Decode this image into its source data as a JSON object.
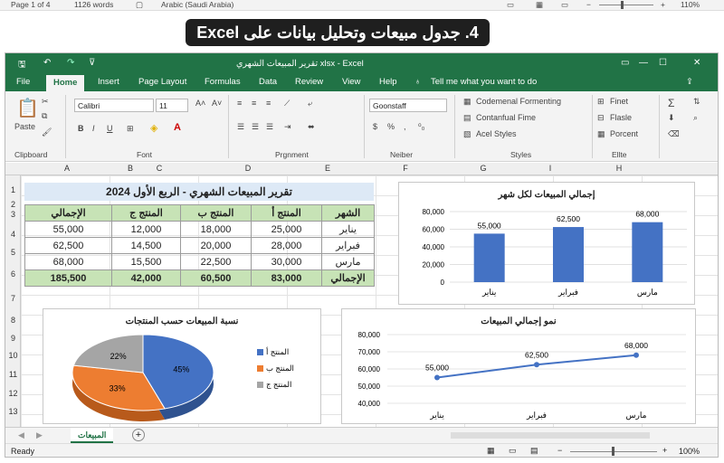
{
  "word_status": {
    "page": "Page 1 of 4",
    "words": "1126 words",
    "language": "Arabic (Saudi Arabia)",
    "zoom": "110%"
  },
  "banner": {
    "title": "4. جدول مبيعات وتحليل بيانات على Excel"
  },
  "window": {
    "title": "تقرير المبيعات الشهري xlsx - Excel",
    "search": "Tell me what you want to do"
  },
  "tabs": [
    "File",
    "Home",
    "Insert",
    "Page Layout",
    "Formulas",
    "Data",
    "Review",
    "View",
    "Help"
  ],
  "ribbon": {
    "clipboard": {
      "paste": "Paste",
      "label": "Clipboard"
    },
    "font": {
      "name": "Calibri",
      "size": "11",
      "label": "Font",
      "bold": "B",
      "italic": "I",
      "underline": "U"
    },
    "alignment": {
      "label": "Prgnment"
    },
    "number": {
      "format": "Goonstaff",
      "label": "Neiber"
    },
    "styles": {
      "items": [
        "Codemenal Formenting",
        "Contanfual Fime",
        "Acel Styles"
      ],
      "label": "Styles"
    },
    "cells": {
      "items": [
        "Finet",
        "Flasle",
        "Porcent"
      ],
      "label": "Ellte"
    }
  },
  "columns": [
    "A",
    "B",
    "C",
    "D",
    "E",
    "F",
    "G",
    "I",
    "H"
  ],
  "rows": [
    "1",
    "2",
    "3",
    "4",
    "5",
    "6",
    "7",
    "8",
    "9",
    "10",
    "11",
    "12",
    "13"
  ],
  "table": {
    "title": "تقرير المبيعات الشهري - الربع الأول 2024",
    "headers": [
      "الشهر",
      "المنتج أ",
      "المنتج ب",
      "المنتج ج",
      "الإجمالي"
    ],
    "rows": [
      [
        "يناير",
        "25,000",
        "18,000",
        "12,000",
        "55,000"
      ],
      [
        "فبراير",
        "28,000",
        "20,000",
        "14,500",
        "62,500"
      ],
      [
        "مارس",
        "30,000",
        "22,500",
        "15,500",
        "68,000"
      ]
    ],
    "total": [
      "الإجمالي",
      "83,000",
      "60,500",
      "42,000",
      "185,500"
    ]
  },
  "bar_chart": {
    "chart_data": {
      "type": "bar",
      "title": "إجمالي المبيعات لكل شهر",
      "categories": [
        "يناير",
        "فبراير",
        "مارس"
      ],
      "values": [
        55000,
        62500,
        68000
      ],
      "data_labels": [
        "55,000",
        "62,500",
        "68,000"
      ],
      "ylim": [
        0,
        80000
      ],
      "yticks": [
        "80,000",
        "60,000",
        "40,000",
        "20,000",
        "0"
      ]
    }
  },
  "pie_chart": {
    "chart_data": {
      "type": "pie",
      "title": "نسبة المبيعات حسب المنتجات",
      "labels": [
        "المنتج أ",
        "المنتج ب",
        "المنتج ج"
      ],
      "values": [
        45,
        33,
        22
      ],
      "data_labels": [
        "45%",
        "33%",
        "22%"
      ],
      "colors": [
        "#4472c4",
        "#ed7d31",
        "#a5a5a5"
      ]
    }
  },
  "line_chart": {
    "chart_data": {
      "type": "line",
      "title": "نمو إجمالي المبيعات",
      "categories": [
        "يناير",
        "فبراير",
        "مارس"
      ],
      "values": [
        55000,
        62500,
        68000
      ],
      "data_labels": [
        "55,000",
        "62,500",
        "68,000"
      ],
      "ylim": [
        40000,
        80000
      ],
      "yticks": [
        "80,000",
        "70,000",
        "60,000",
        "50,000",
        "40,000"
      ]
    }
  },
  "sheet": {
    "tab": "المبيعات",
    "add": "+"
  },
  "status": {
    "ready": "Ready",
    "zoom": "100%"
  },
  "colors": {
    "excel_green": "#217346",
    "bar_blue": "#4472c4",
    "header_green": "#c7e3b6"
  }
}
